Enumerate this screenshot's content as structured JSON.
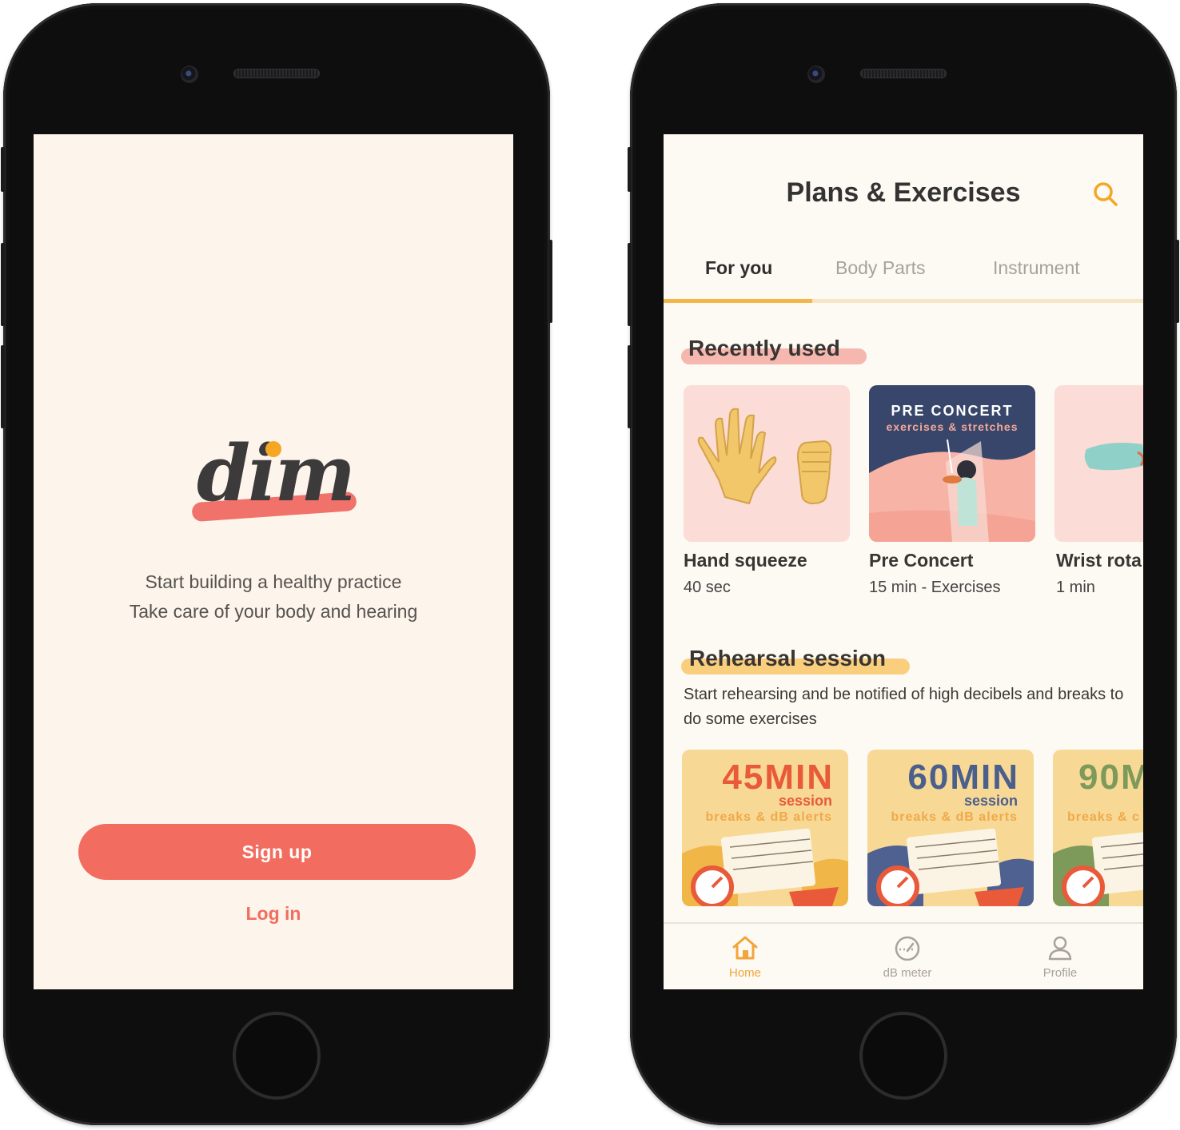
{
  "colors": {
    "coral": "#f26d5f",
    "amber": "#f2b748",
    "cream": "#fdf5eb",
    "dark_text": "#333333"
  },
  "welcome": {
    "logo_text": "dim",
    "tagline_line1": "Start building a healthy practice",
    "tagline_line2": "Take care of your body and hearing",
    "signup_label": "Sign up",
    "login_label": "Log in"
  },
  "plans": {
    "title": "Plans & Exercises",
    "search_icon": "search-icon",
    "tabs": [
      {
        "label": "For you",
        "active": true
      },
      {
        "label": "Body Parts",
        "active": false
      },
      {
        "label": "Instrument",
        "active": false
      }
    ],
    "recently_used": {
      "title": "Recently used",
      "cards": [
        {
          "title": "Hand squeeze",
          "subtitle": "40 sec"
        },
        {
          "title": "Pre Concert",
          "subtitle": "15 min - Exercises",
          "image_heading": "PRE CONCERT",
          "image_sub": "exercises & stretches"
        },
        {
          "title": "Wrist rota",
          "subtitle": "1 min"
        }
      ]
    },
    "rehearsal": {
      "title": "Rehearsal session",
      "description": "Start rehearsing and be notified of high decibels and breaks to do some exercises",
      "sessions": [
        {
          "minutes": "45MIN",
          "session": "session",
          "alerts": "breaks & dB alerts",
          "accent": "#e85a3a",
          "bg": "#f7d894"
        },
        {
          "minutes": "60MIN",
          "session": "session",
          "alerts": "breaks & dB alerts",
          "accent": "#4b5f8d",
          "bg": "#f7d894"
        },
        {
          "minutes": "90M",
          "session": "",
          "alerts": "breaks & c",
          "accent": "#7d9a5b",
          "bg": "#f7d894"
        }
      ]
    },
    "nav": [
      {
        "label": "Home",
        "icon": "home-icon",
        "active": true
      },
      {
        "label": "dB meter",
        "icon": "gauge-icon",
        "active": false
      },
      {
        "label": "Profile",
        "icon": "user-icon",
        "active": false
      }
    ]
  }
}
